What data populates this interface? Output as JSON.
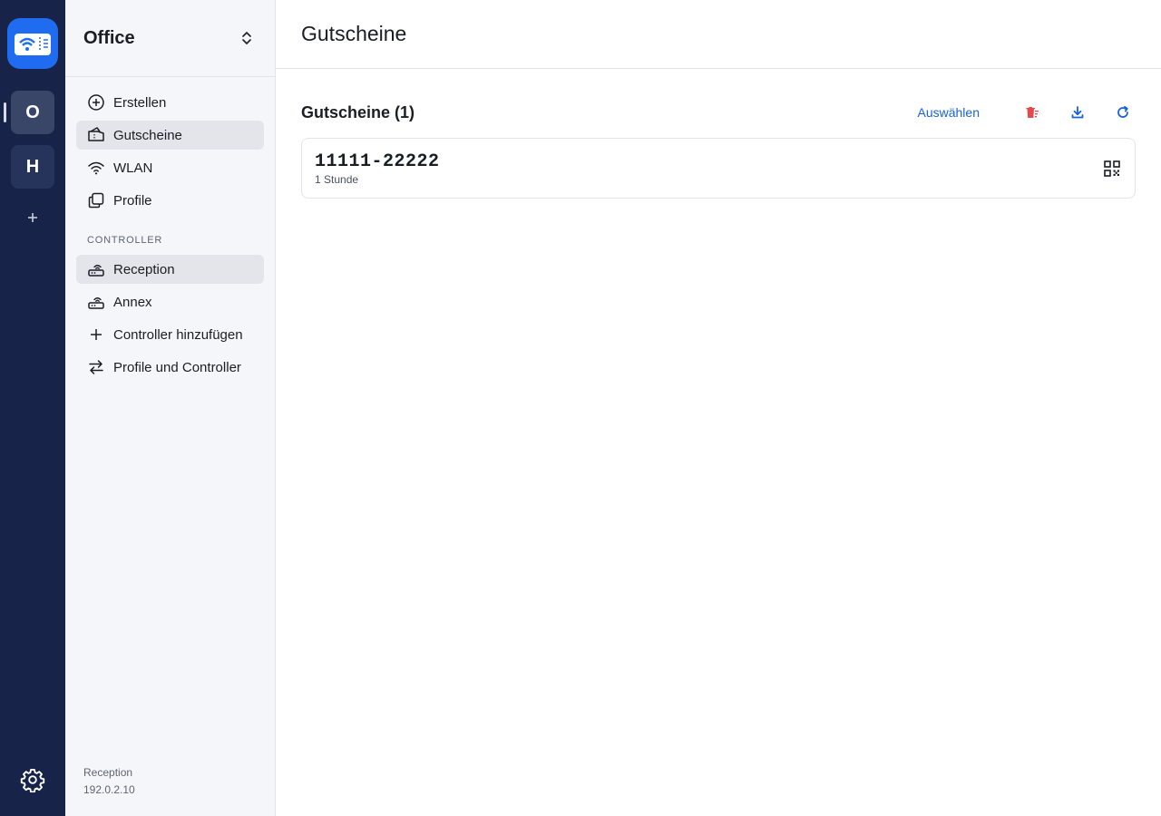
{
  "rail": {
    "sites": [
      {
        "letter": "O"
      },
      {
        "letter": "H"
      }
    ]
  },
  "sidebar": {
    "title": "Office",
    "items": [
      {
        "label": "Erstellen",
        "icon": "plus-circle-icon"
      },
      {
        "label": "Gutscheine",
        "icon": "ticket-icon"
      },
      {
        "label": "WLAN",
        "icon": "wifi-icon"
      },
      {
        "label": "Profile",
        "icon": "copy-icon"
      }
    ],
    "section_label": "CONTROLLER",
    "controllers": [
      {
        "label": "Reception",
        "icon": "router-icon"
      },
      {
        "label": "Annex",
        "icon": "router-icon"
      },
      {
        "label": "Controller hinzufügen",
        "icon": "plus-icon"
      },
      {
        "label": "Profile und Controller",
        "icon": "arrows-swap-icon"
      }
    ],
    "footer": {
      "name": "Reception",
      "ip": "192.0.2.10"
    }
  },
  "main": {
    "title": "Gutscheine",
    "section_title": "Gutscheine (1)",
    "select_label": "Auswählen",
    "vouchers": [
      {
        "code": "11111-22222",
        "duration": "1 Stunde"
      }
    ]
  },
  "colors": {
    "rail_bg": "#172349",
    "accent": "#1762d6",
    "danger": "#e5484d",
    "logo_bg": "#1f6cf0"
  }
}
